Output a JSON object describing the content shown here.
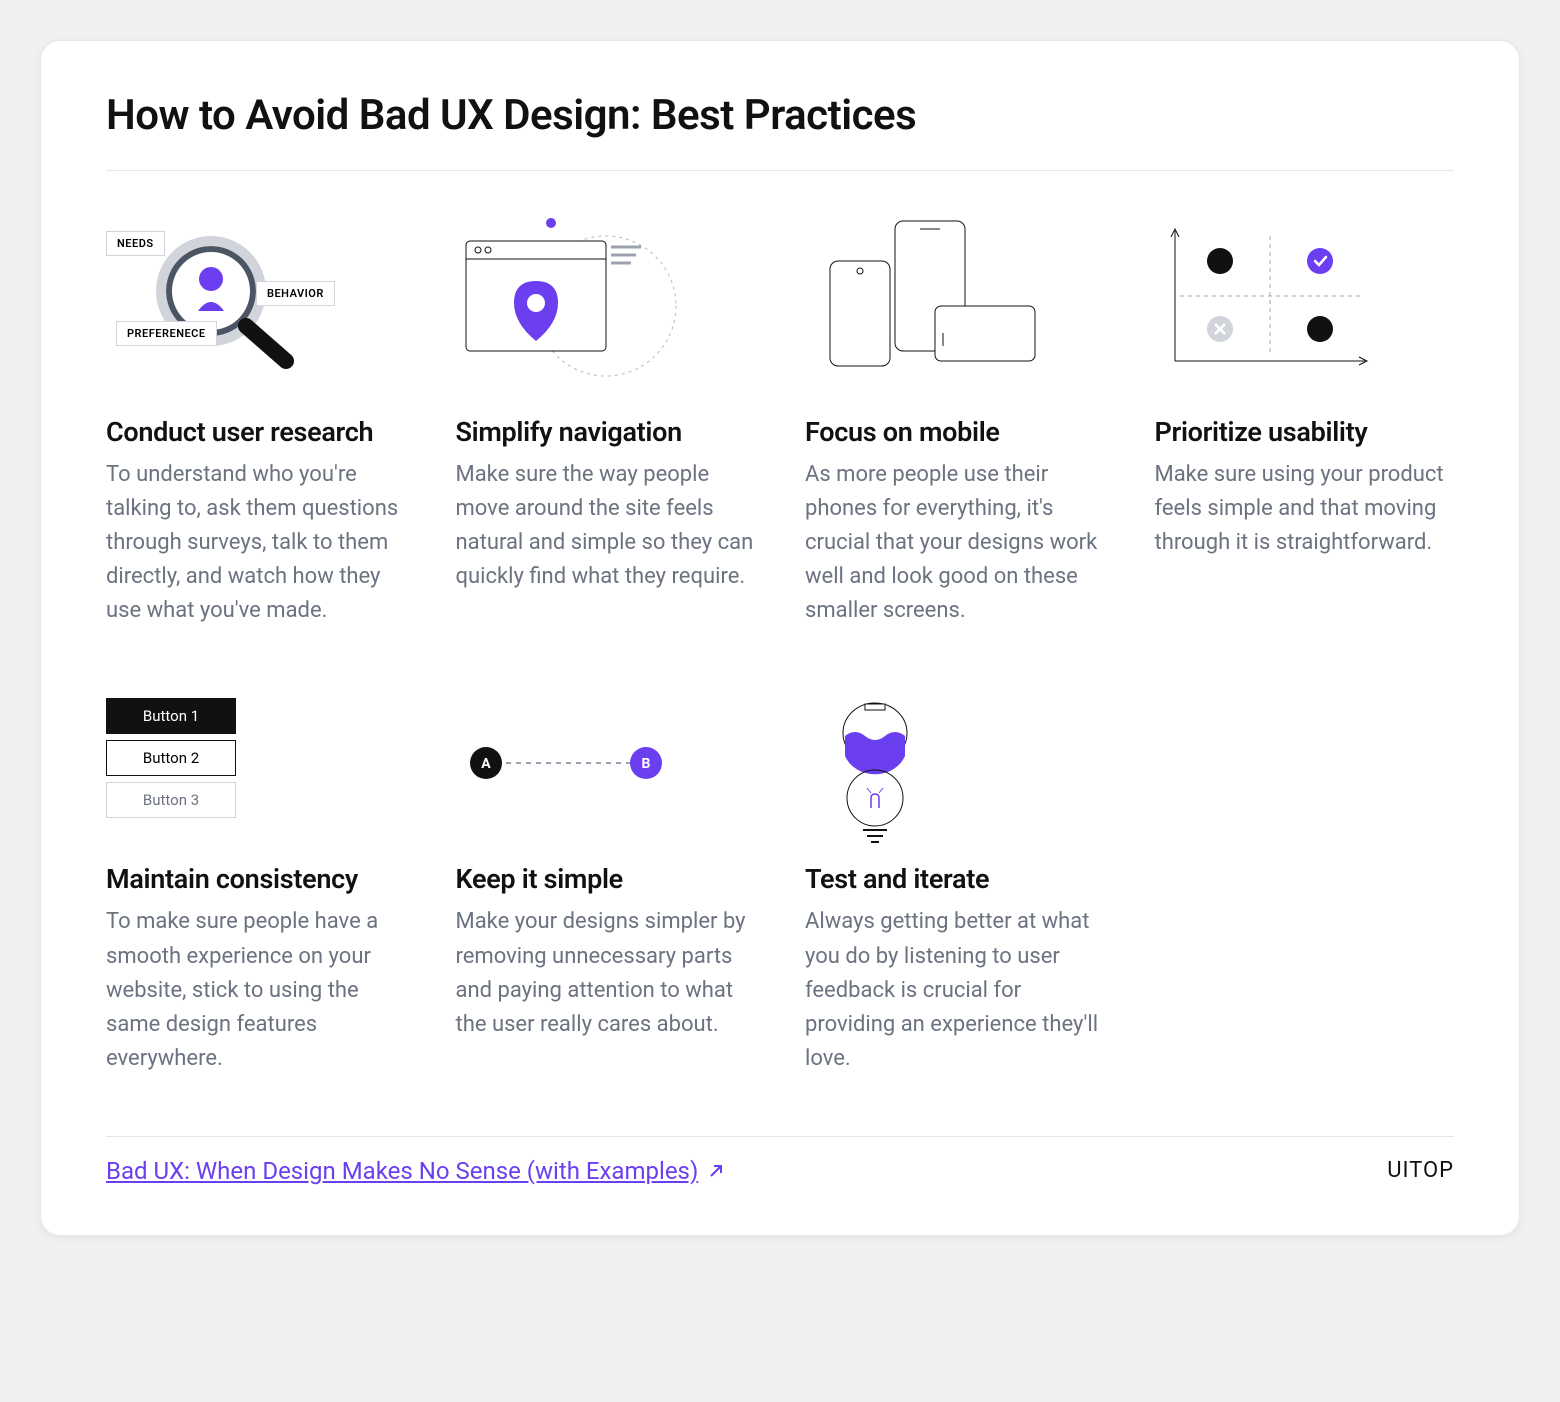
{
  "title": "How to Avoid Bad UX Design: Best Practices",
  "items": [
    {
      "heading": "Conduct user research",
      "body": "To understand who you're talking to, ask them questions through surveys, talk to them directly, and watch how they use what you've made.",
      "tags": [
        "NEEDS",
        "BEHAVIOR",
        "PREFERENECE"
      ]
    },
    {
      "heading": "Simplify navigation",
      "body": "Make sure the way people move around the site feels natural and simple so they can quickly find what they require."
    },
    {
      "heading": "Focus on mobile",
      "body": "As more people use their phones for everything, it's crucial that your designs work well and look good on these smaller screens."
    },
    {
      "heading": "Prioritize usability",
      "body": "Make sure using your product feels simple and that moving through it is straightforward."
    },
    {
      "heading": "Maintain consistency",
      "body": "To make sure people have a smooth experience on your website, stick to using the same design features everywhere.",
      "buttons": [
        "Button 1",
        "Button 2",
        "Button 3"
      ]
    },
    {
      "heading": "Keep it simple",
      "body": "Make your designs simpler by removing unnecessary parts and paying attention to what the user really cares about.",
      "nodes": [
        "A",
        "B"
      ]
    },
    {
      "heading": "Test and iterate",
      "body": "Always getting better at what you do by listening to user feedback is crucial for providing an experience they'll love."
    }
  ],
  "footer_link": "Bad UX: When Design Makes No Sense (with Examples)",
  "brand": "UITOP",
  "colors": {
    "accent": "#6b3ff0"
  }
}
